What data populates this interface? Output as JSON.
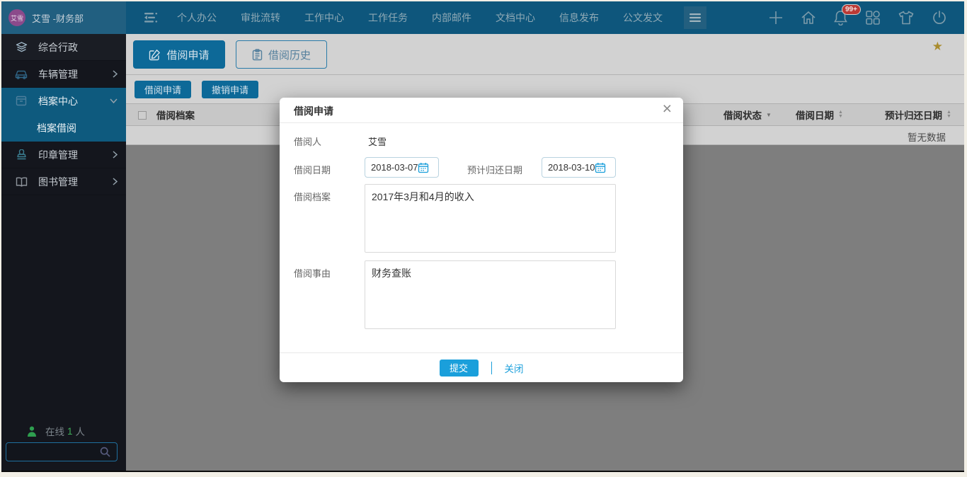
{
  "user": {
    "avatar": "艾雪",
    "name": "艾雪 -财务部"
  },
  "topbar": {
    "menu": [
      "个人办公",
      "审批流转",
      "工作中心",
      "工作任务",
      "内部邮件",
      "文档中心",
      "信息发布",
      "公文发文"
    ],
    "notification_badge": "99+"
  },
  "sidebar": {
    "items": [
      {
        "label": "综合行政",
        "icon": "layers-icon"
      },
      {
        "label": "车辆管理",
        "icon": "car-icon",
        "chevron": "right"
      },
      {
        "label": "档案中心",
        "icon": "archive-icon",
        "chevron": "down"
      },
      {
        "label": "档案借阅",
        "child": true
      },
      {
        "label": "印章管理",
        "icon": "stamp-icon",
        "chevron": "right"
      },
      {
        "label": "图书管理",
        "icon": "book-icon",
        "chevron": "right"
      }
    ],
    "online_prefix": "在线",
    "online_count": "1",
    "online_suffix": "人"
  },
  "content": {
    "tabs": [
      {
        "label": "借阅申请",
        "icon": "edit-icon"
      },
      {
        "label": "借阅历史",
        "icon": "history-icon"
      }
    ],
    "actions": [
      "借阅申请",
      "撤销申请"
    ],
    "table": {
      "columns": [
        "借阅档案",
        "借阅状态",
        "借阅日期",
        "预计归还日期"
      ],
      "empty": "暂无数据"
    }
  },
  "modal": {
    "title": "借阅申请",
    "borrower_label": "借阅人",
    "borrower_value": "艾雪",
    "date_label": "借阅日期",
    "date_value": "2018-03-07",
    "return_label": "预计归还日期",
    "return_value": "2018-03-10",
    "archive_label": "借阅档案",
    "archive_value": "2017年3月和4月的收入",
    "reason_label": "借阅事由",
    "reason_value": "财务查账",
    "submit": "提交",
    "close": "关闭"
  },
  "icons": {
    "close": "×",
    "star": "★",
    "caret_down": "▼",
    "caret_up": "▲",
    "chevron_right": "❯",
    "chevron_down": "❯"
  },
  "colors": {
    "accent": "#1a9fdb",
    "topbar": "#0e567c",
    "sidebar": "#14161d",
    "selected_nav": "#0e5a7e",
    "badge": "#bb3a35",
    "star": "#a98c2e",
    "dimmed_button": "#0d6998"
  }
}
